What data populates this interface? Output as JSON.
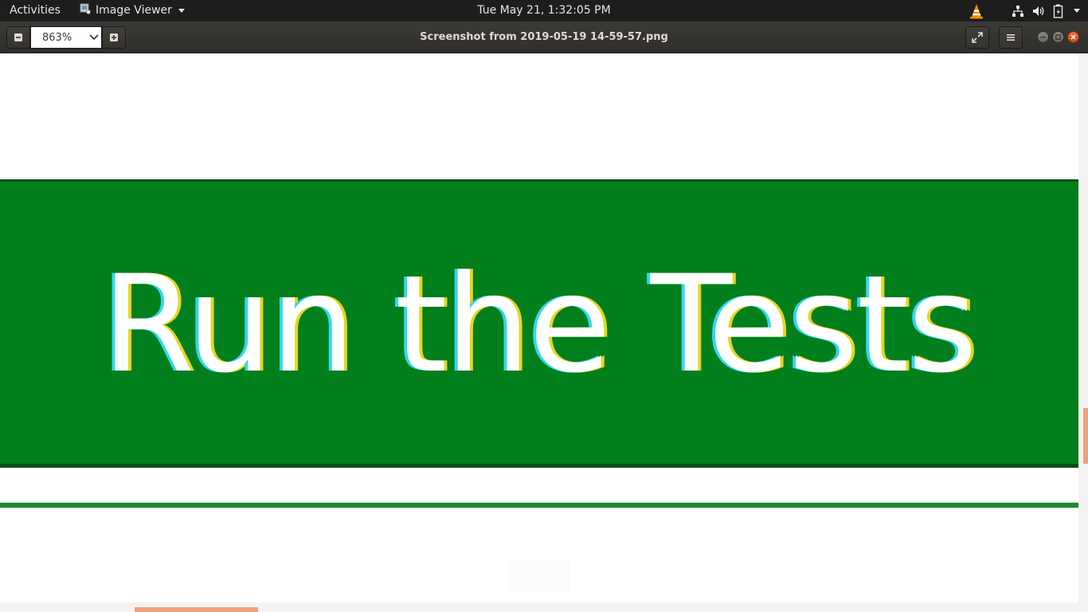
{
  "system": {
    "activities_label": "Activities",
    "app_menu_label": "Image Viewer",
    "clock": "Tue May 21,  1:32:05 PM",
    "tray_icons": [
      "vlc-icon",
      "network-icon",
      "volume-icon",
      "battery-icon",
      "system-menu-caret"
    ]
  },
  "viewer": {
    "window_title": "Screenshot from 2019-05-19 14-59-57.png",
    "zoom_value": "863%",
    "zoom_out_icon": "minus-icon",
    "zoom_in_icon": "plus-icon",
    "fullscreen_icon": "expand-icon",
    "menu_icon": "hamburger-icon"
  },
  "image_content": {
    "button_text": "Run the Tests",
    "band_color": "#007f1c",
    "text_color": "#ffffff"
  },
  "scrollbars": {
    "accent_color": "#f0a07c"
  }
}
